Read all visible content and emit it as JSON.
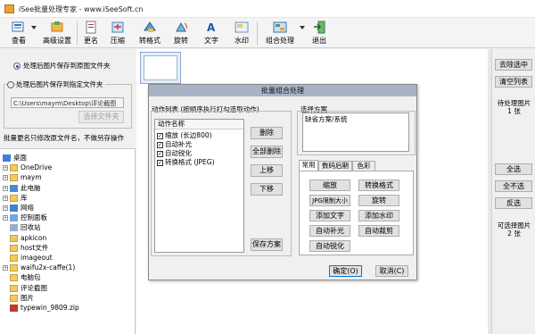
{
  "window": {
    "title": "iSee批量处理专家 - www.iSeeSoft.cn"
  },
  "toolbar": {
    "buttons": [
      {
        "label": "查看",
        "icon": "view-icon"
      },
      {
        "label": "高级设置",
        "icon": "advanced-settings-icon"
      },
      {
        "label": "更名",
        "icon": "rename-icon"
      },
      {
        "label": "压缩",
        "icon": "compress-icon"
      },
      {
        "label": "转格式",
        "icon": "convert-format-icon"
      },
      {
        "label": "旋转",
        "icon": "rotate-icon"
      },
      {
        "label": "文字",
        "icon": "text-icon"
      },
      {
        "label": "水印",
        "icon": "watermark-icon"
      },
      {
        "label": "组合处理",
        "icon": "combo-process-icon"
      },
      {
        "label": "退出",
        "icon": "exit-icon"
      }
    ]
  },
  "left": {
    "radio_same_folder": "处理后图片保存到原图文件夹",
    "radio_specified_folder": "处理后图片保存到指定文件夹",
    "path_value": "C:\\Users\\maym\\Desktop\\评论截图",
    "choose_folder_btn": "选择文件夹",
    "note": "批量更名只修改原文件名，不做另存操作"
  },
  "tree": {
    "items": [
      {
        "label": "桌面",
        "level": 0,
        "exp": "",
        "icon": "desktop"
      },
      {
        "label": "OneDrive",
        "level": 1,
        "exp": "+",
        "icon": "folder"
      },
      {
        "label": "maym",
        "level": 1,
        "exp": "+",
        "icon": "folder"
      },
      {
        "label": "此电脑",
        "level": 1,
        "exp": "+",
        "icon": "pc"
      },
      {
        "label": "库",
        "level": 1,
        "exp": "+",
        "icon": "folder"
      },
      {
        "label": "网络",
        "level": 1,
        "exp": "+",
        "icon": "network"
      },
      {
        "label": "控制面板",
        "level": 1,
        "exp": "+",
        "icon": "panel"
      },
      {
        "label": "回收站",
        "level": 1,
        "exp": "",
        "icon": "bin"
      },
      {
        "label": "apkicon",
        "level": 1,
        "exp": "",
        "icon": "folder"
      },
      {
        "label": "host文件",
        "level": 1,
        "exp": "",
        "icon": "folder"
      },
      {
        "label": "imageout",
        "level": 1,
        "exp": "",
        "icon": "folder"
      },
      {
        "label": "waifu2x-caffe(1)",
        "level": 1,
        "exp": "+",
        "icon": "folder"
      },
      {
        "label": "电脑包",
        "level": 1,
        "exp": "",
        "icon": "folder"
      },
      {
        "label": "评论截图",
        "level": 1,
        "exp": "",
        "icon": "folder"
      },
      {
        "label": "图片",
        "level": 1,
        "exp": "",
        "icon": "folder"
      },
      {
        "label": "typewin_9809.zip",
        "level": 1,
        "exp": "",
        "icon": "zip"
      }
    ]
  },
  "right": {
    "clear_selected": "去除选中",
    "clear_list": "清空列表",
    "pending_label": "待处理图片",
    "pending_count": "1 张",
    "select_all": "全选",
    "select_none": "全不选",
    "invert": "反选",
    "selectable_label": "可选择图片",
    "selectable_count": "2 张"
  },
  "dialog": {
    "title": "批量组合处理",
    "actions_label": "动作列表 (按顺序执行打勾选取动作)",
    "list_header": "动作名称",
    "actions": [
      {
        "label": "缩放 (长边800)",
        "checked": true
      },
      {
        "label": "自动补光",
        "checked": true
      },
      {
        "label": "自动锐化",
        "checked": true
      },
      {
        "label": "转换格式 (JPEG)",
        "checked": true
      }
    ],
    "delete_btn": "删除",
    "delete_all_btn": "全部删除",
    "move_up_btn": "上移",
    "move_down_btn": "下移",
    "save_plan_btn": "保存方案",
    "plan_label": "选择方案",
    "plan_value": "缺省方案/系统",
    "tabs": [
      "常用",
      "数码后期",
      "色彩"
    ],
    "tab_buttons": [
      "缩放",
      "转换格式",
      "JPG限制大小",
      "旋转",
      "添加文字",
      "添加水印",
      "自动补光",
      "自动裁剪",
      "自动锐化"
    ],
    "ok_btn": "确定(O)",
    "cancel_btn": "取消(C)"
  }
}
